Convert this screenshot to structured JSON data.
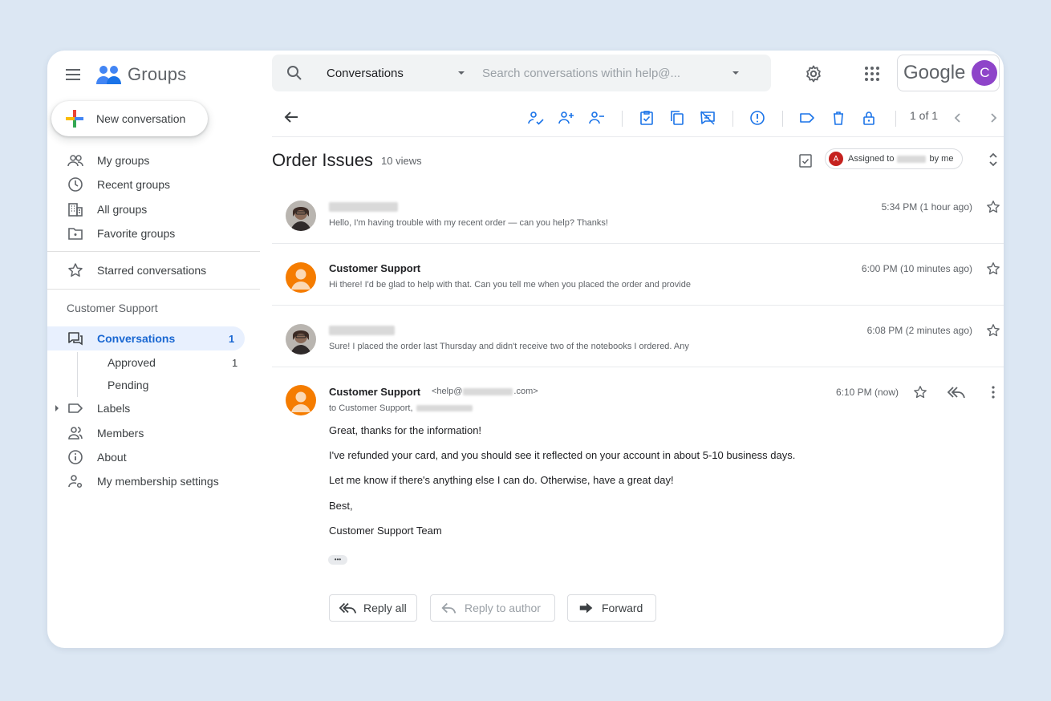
{
  "app": {
    "name": "Groups",
    "google_word": "Google",
    "account_initial": "C"
  },
  "search": {
    "scope": "Conversations",
    "placeholder": "Search conversations within help@..."
  },
  "nav": {
    "new_conversation": "New conversation",
    "items": [
      "My groups",
      "Recent groups",
      "All groups",
      "Favorite groups"
    ],
    "starred": "Starred conversations",
    "group_name": "Customer Support",
    "conversations": {
      "label": "Conversations",
      "count": "1"
    },
    "approved": {
      "label": "Approved",
      "count": "1"
    },
    "pending": "Pending",
    "labels": "Labels",
    "members": "Members",
    "about": "About",
    "membership": "My membership settings"
  },
  "toolbar": {
    "pager": "1 of 1"
  },
  "thread": {
    "title": "Order Issues",
    "views": "10 views",
    "assigned_prefix": "Assigned to",
    "assigned_suffix": "by me",
    "assignee_initial": "A"
  },
  "messages": [
    {
      "sender": "",
      "snippet": "Hello, I'm having trouble with my recent order — can you help? Thanks!",
      "time": "5:34 PM (1 hour ago)"
    },
    {
      "sender": "Customer Support",
      "snippet": "Hi there! I'd be glad to help with that. Can you tell me when you placed the order and provide",
      "time": "6:00 PM (10 minutes ago)"
    },
    {
      "sender": "",
      "snippet": "Sure! I placed the order last Thursday and didn't receive two of the notebooks I ordered. Any",
      "time": "6:08 PM (2 minutes ago)"
    }
  ],
  "open_message": {
    "sender": "Customer Support",
    "email_prefix": "<help@",
    "email_suffix": ".com>",
    "to": "to Customer Support,",
    "time": "6:10 PM (now)",
    "body": [
      "Great, thanks for the information!",
      "I've refunded your card, and you should see it reflected on your account in about 5-10 business days.",
      "Let me know if there's anything else I can do. Otherwise, have a great day!",
      "Best,",
      "Customer Support Team"
    ],
    "ellipsis": "•••"
  },
  "actions": {
    "reply_all": "Reply all",
    "reply_author": "Reply to author",
    "forward": "Forward"
  }
}
